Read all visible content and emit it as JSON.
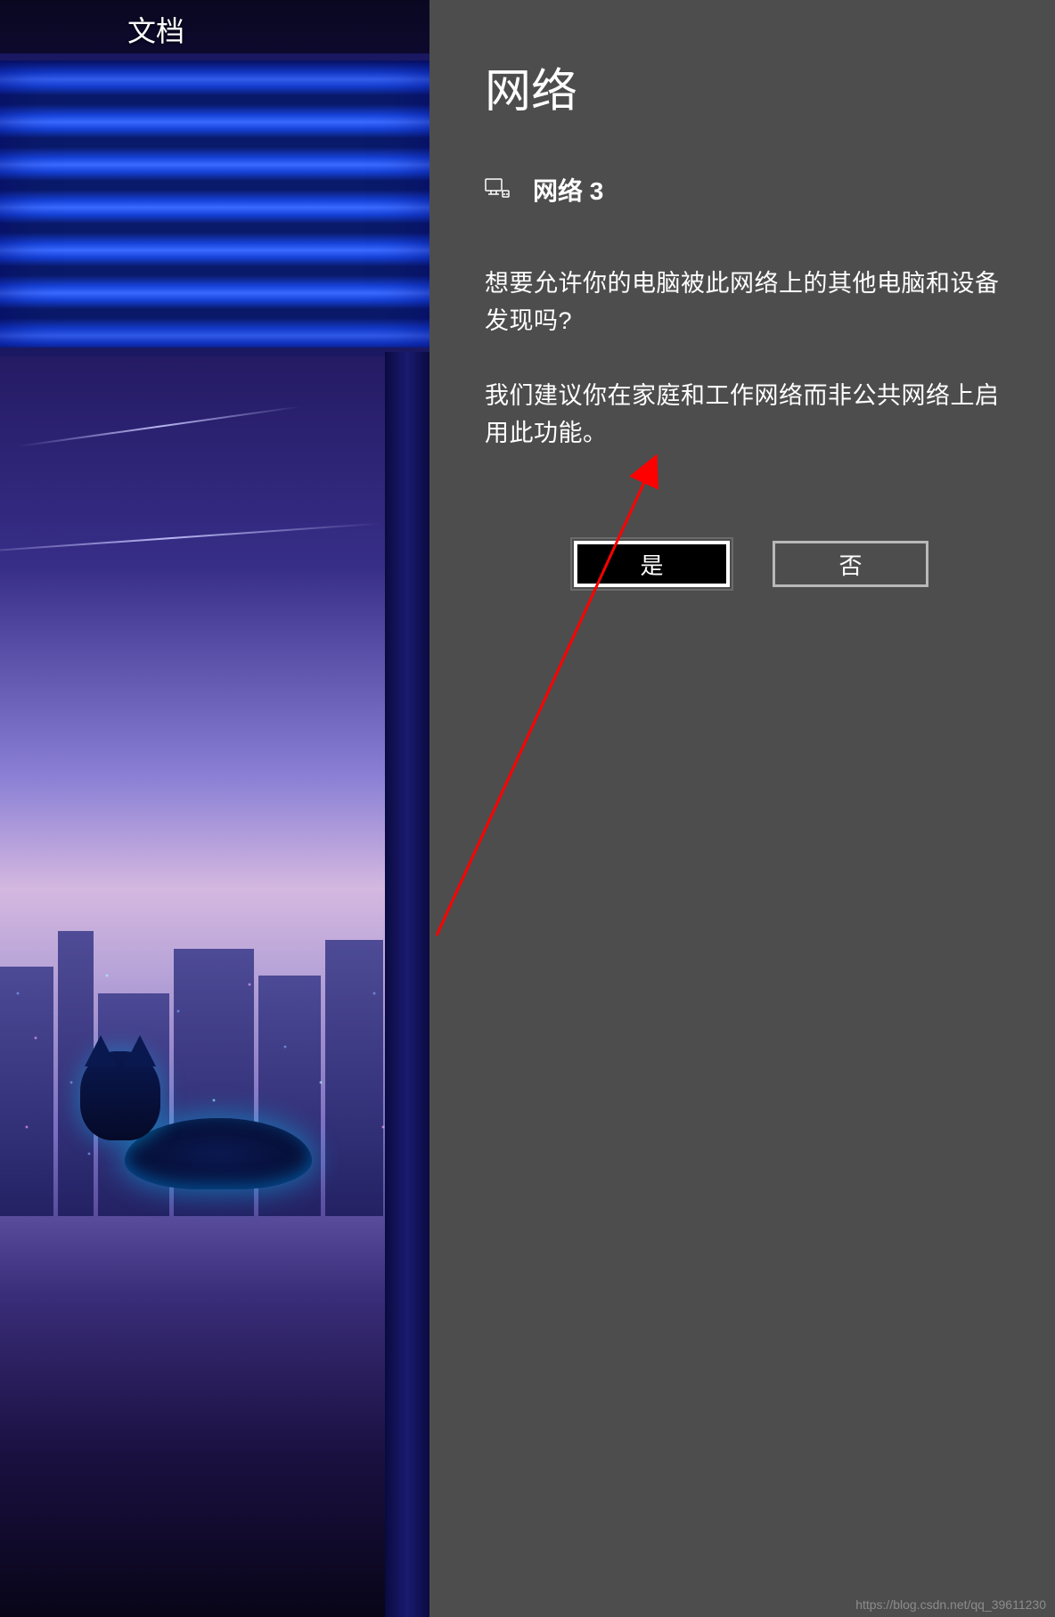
{
  "desktop": {
    "icon_label": "文档"
  },
  "panel": {
    "title": "网络",
    "network_name": "网络 3",
    "question1": "想要允许你的电脑被此网络上的其他电脑和设备发现吗?",
    "question2": "我们建议你在家庭和工作网络而非公共网络上启用此功能。",
    "buttons": {
      "yes": "是",
      "no": "否"
    }
  },
  "annotation": {
    "arrow_color": "#ff0000"
  },
  "watermark": "https://blog.csdn.net/qq_39611230"
}
